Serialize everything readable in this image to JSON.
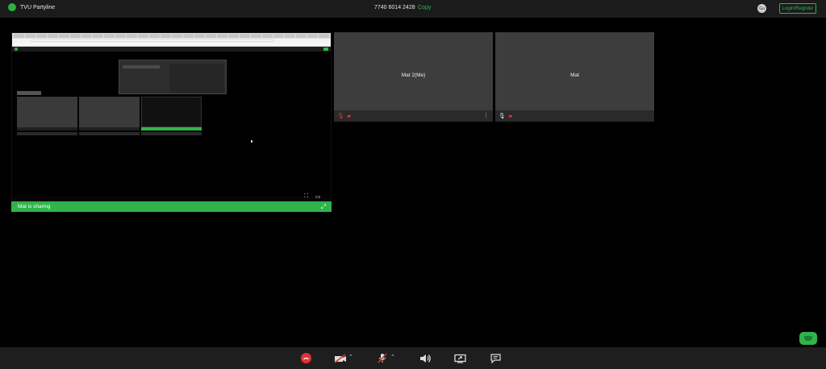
{
  "header": {
    "app_name": "TVU Partyline",
    "meeting_id": "7740 6014 2428",
    "copy_label": "Copy",
    "avatar_initials": "Gu",
    "login_label": "Login/Register"
  },
  "share": {
    "label": "Mat is sharing"
  },
  "participants": [
    {
      "name": "Mat 2(Me)"
    },
    {
      "name": "Mat"
    }
  ],
  "colors": {
    "accent": "#2fb44c",
    "muted": "#e03333",
    "tile": "#3d3d3d",
    "bar": "#1e1e1e"
  },
  "controls": {
    "icons": [
      "hangup-icon",
      "camera-off-icon",
      "mic-off-icon",
      "speaker-icon",
      "screen-share-icon",
      "chat-icon"
    ]
  }
}
